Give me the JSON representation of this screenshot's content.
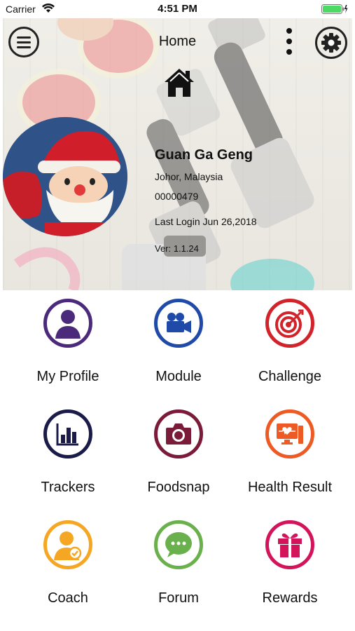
{
  "status_bar": {
    "carrier": "Carrier",
    "time": "4:51 PM"
  },
  "header": {
    "title": "Home"
  },
  "profile": {
    "name": "Guan Ga Geng",
    "location": "Johor, Malaysia",
    "id": "00000479",
    "last_login": "Last Login Jun 26,2018",
    "version": "Ver: 1.1.24"
  },
  "menu": [
    {
      "label": "My Profile",
      "icon": "person-icon",
      "color": "#4b2a7b"
    },
    {
      "label": "Module",
      "icon": "video-camera-icon",
      "color": "#1f4aa8"
    },
    {
      "label": "Challenge",
      "icon": "target-icon",
      "color": "#d2232a"
    },
    {
      "label": "Trackers",
      "icon": "bar-chart-icon",
      "color": "#1b1b4a"
    },
    {
      "label": "Foodsnap",
      "icon": "camera-icon",
      "color": "#7b1b3a"
    },
    {
      "label": "Health Result",
      "icon": "health-monitor-icon",
      "color": "#ee5a24"
    },
    {
      "label": "Coach",
      "icon": "coach-icon",
      "color": "#f5a623"
    },
    {
      "label": "Forum",
      "icon": "chat-bubble-icon",
      "color": "#6ab04c"
    },
    {
      "label": "Rewards",
      "icon": "gift-icon",
      "color": "#d4145a"
    }
  ]
}
